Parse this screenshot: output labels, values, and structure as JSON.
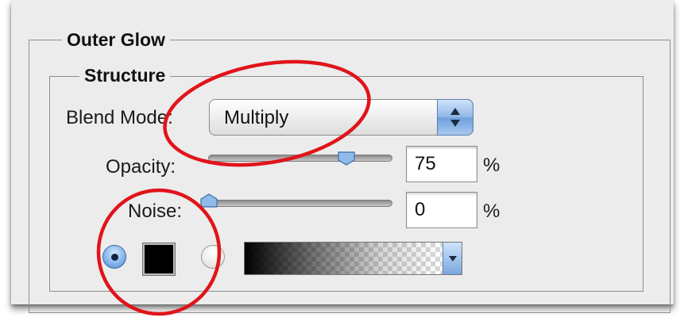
{
  "outer_group": {
    "title": "Outer Glow"
  },
  "structure": {
    "title": "Structure",
    "blend_mode": {
      "label": "Blend Mode:",
      "value": "Multiply"
    },
    "opacity": {
      "label": "Opacity:",
      "value": "75",
      "unit": "%",
      "slider_fraction": 0.75
    },
    "noise": {
      "label": "Noise:",
      "value": "0",
      "unit": "%",
      "slider_fraction": 0.0
    },
    "fill_type": {
      "selected": "color",
      "color_swatch": "#000000"
    }
  },
  "icons": {
    "stepper": "up-down-arrows-icon",
    "gradient_dropdown": "chevron-down-icon"
  },
  "colors": {
    "annotation": "#e0141a",
    "selection_blue": "#6e9fdc"
  }
}
